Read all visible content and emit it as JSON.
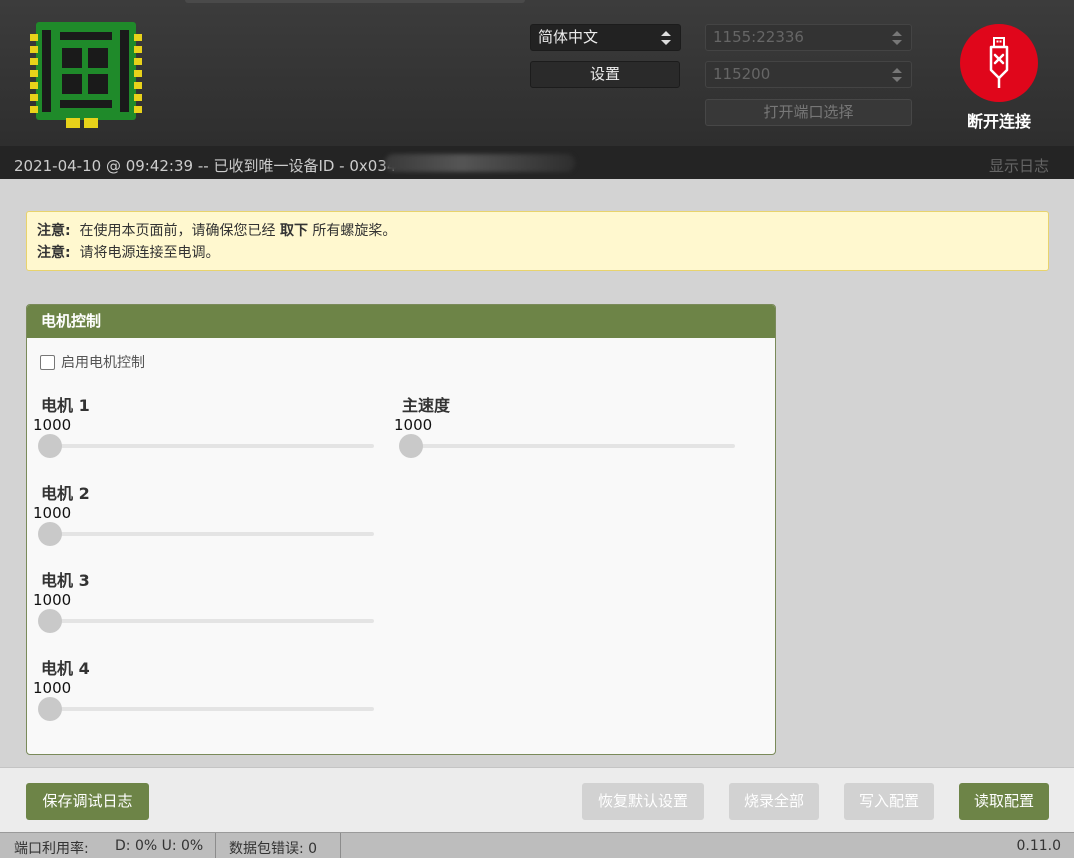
{
  "header": {
    "language_select": "简体中文",
    "settings_button": "设置",
    "port_select": "1155:22336",
    "baud_select": "115200",
    "port_chooser_button": "打开端口选择",
    "connect_label": "断开连接"
  },
  "logbar": {
    "message": "2021-04-10 @ 09:42:39 -- 已收到唯一设备ID - 0x034",
    "show_log": "显示日志"
  },
  "notice": {
    "prefix1": "注意:",
    "line1_before": "在使用本页面前，请确保您已经",
    "line1_bold": "取下",
    "line1_after": "所有螺旋桨。",
    "prefix2": "注意:",
    "line2": "请将电源连接至电调。"
  },
  "motor_panel": {
    "title": "电机控制",
    "enable_label": "启用电机控制",
    "motors": [
      {
        "title": "电机 1",
        "value": "1000"
      },
      {
        "title": "电机 2",
        "value": "1000"
      },
      {
        "title": "电机 3",
        "value": "1000"
      },
      {
        "title": "电机 4",
        "value": "1000"
      }
    ],
    "master": {
      "title": "主速度",
      "value": "1000"
    }
  },
  "toolbar": {
    "save_log": "保存调试日志",
    "restore_defaults": "恢复默认设置",
    "flash_all": "烧录全部",
    "write_config": "写入配置",
    "read_config": "读取配置"
  },
  "statusbar": {
    "port_usage_label": "端口利用率:",
    "port_usage_value": "D: 0% U: 0%",
    "packet_errors": "数据包错误: 0",
    "version": "0.11.0"
  },
  "colors": {
    "accent_green": "#6d8447",
    "connect_red": "#e0061b",
    "notice_bg": "#fff8cf"
  }
}
